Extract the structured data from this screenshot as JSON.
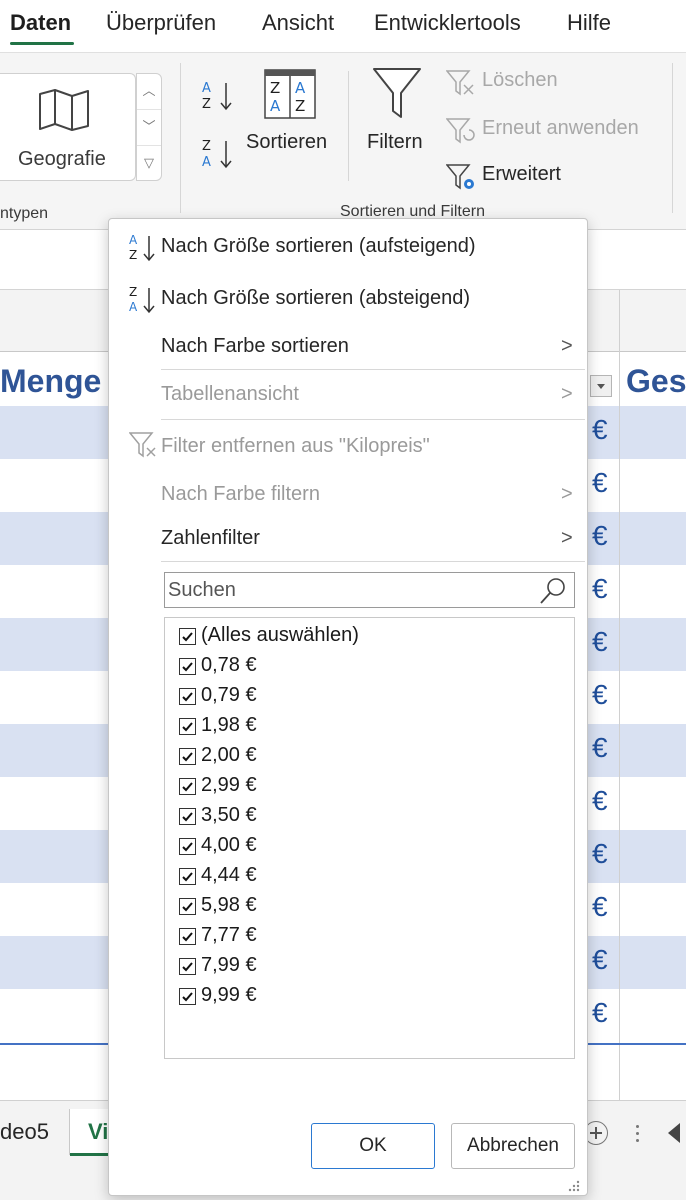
{
  "ribbon_tabs": [
    "Daten",
    "Überprüfen",
    "Ansicht",
    "Entwicklertools",
    "Hilfe"
  ],
  "ribbon": {
    "geography_label": "Geografie",
    "left_group_label": "ntypen",
    "sort_label": "Sortieren",
    "filter_label": "Filtern",
    "clear_label": "Löschen",
    "reapply_label": "Erneut anwenden",
    "advanced_label": "Erweitert",
    "sort_filter_group_label": "Sortieren und Filtern"
  },
  "sheet": {
    "header_menge": "Menge",
    "header_ges": "Ges",
    "currency_symbol": "€"
  },
  "sheet_tabs": [
    "deo5",
    "Vi"
  ],
  "filter_menu": {
    "sort_asc": "Nach Größe sortieren (aufsteigend)",
    "sort_desc": "Nach Größe sortieren (absteigend)",
    "sort_by_color": "Nach Farbe sortieren",
    "table_view": "Tabellenansicht",
    "remove_filter": "Filter entfernen aus \"Kilopreis\"",
    "filter_by_color": "Nach Farbe filtern",
    "number_filter": "Zahlenfilter",
    "search_placeholder": "Suchen",
    "select_all": "(Alles auswählen)",
    "values": [
      "0,78 €",
      "0,79 €",
      "1,98 €",
      "2,00 €",
      "2,99 €",
      "3,50 €",
      "4,00 €",
      "4,44 €",
      "5,98 €",
      "7,77 €",
      "7,99 €",
      "9,99 €"
    ],
    "ok_label": "OK",
    "cancel_label": "Abbrechen"
  }
}
